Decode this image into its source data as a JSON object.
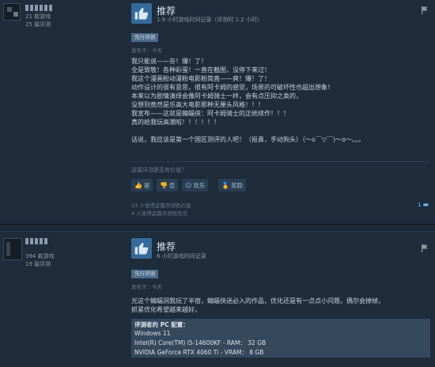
{
  "reviews": [
    {
      "author": {
        "games": "21 款游戏",
        "reviews": "25 篇评测"
      },
      "recommend_label": "推荐",
      "hours": "1.9 小时游戏时间记录（评测时 1.2 小时）",
      "badge": "先行评测",
      "posted": "发布于：今天",
      "lines": [
        "我只能说——夯！爆！了！",
        "全是致敬！各种彩蛋！一直在截图，没停下来过！",
        "我这个漫画粉动漫粉电影粉简直——爽！爆！了！",
        "动作设计的很有意思，很有阿卡姆的感觉，场景的可破坏性也超出想象！",
        "本来以为剧情演绎会像阿卡姆骑士一样，会有点压抑之类的，",
        "没想到竟然是乐高大电影那种无厘头风格！！！",
        "我宣布——这就是蝙蝠侠：阿卡姆骑士的正统续作！！！",
        "真的给我玩高潮啦！！！！！！",
        "",
        "话说，我应该是第一个国区测评的人吧！（抠鼻，手动狗头）（～o￣▽￣)～o～。。。"
      ],
      "helpful_question": "这篇评测是否有价值？",
      "buttons": {
        "yes": "是",
        "no": "否",
        "funny": "欢乐",
        "award": "奖励"
      },
      "stats": [
        "23 人觉得这篇评测有价值",
        "4 人觉得这篇评测很欢乐"
      ],
      "comments": "1"
    },
    {
      "author": {
        "games": "394 款游戏",
        "reviews": "19 篇评测"
      },
      "recommend_label": "推荐",
      "hours": "6 小时游戏时间记录",
      "badge": "先行评测",
      "posted": "发布于：今天",
      "lines": [
        "光这个蝙蝠洞我玩了半宿，蝙蝠侠迷必入的作品，优化还是有一点点小问题，偶尔会掉帧，",
        "抓紧优化希望越来越好。"
      ],
      "spec": {
        "title": "评测者的 PC 配置：",
        "lines": [
          "Windows 11",
          "Intel(R) Core(TM) i5-14600KF - RAM： 32 GB",
          "NVIDIA GeForce RTX 4060 Ti - VRAM： 8 GB"
        ]
      }
    }
  ],
  "colors": {
    "background": "#1b2838",
    "accent": "#66c0f4",
    "thumb": "#356b9a"
  },
  "icons": [
    "thumbs-up-icon",
    "flag-icon",
    "smile-icon",
    "award-icon",
    "comment-icon"
  ]
}
